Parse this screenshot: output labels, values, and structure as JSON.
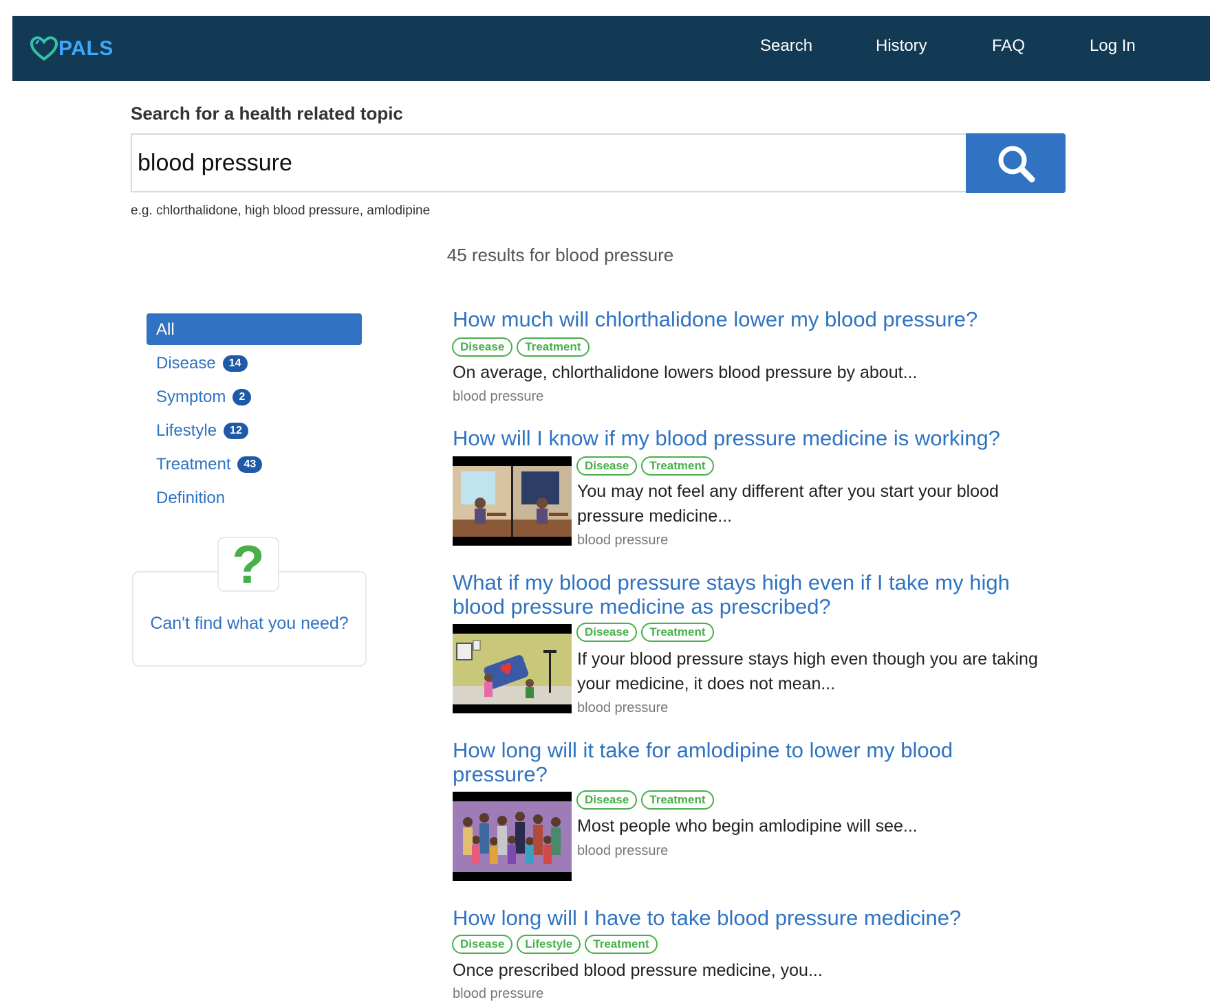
{
  "brand": {
    "name": "PALS",
    "colors": {
      "nav_bg": "#123a54",
      "accent": "#2f73c2",
      "tag_green": "#47b04a"
    }
  },
  "nav": {
    "links": [
      "Search",
      "History",
      "FAQ",
      "Log In"
    ]
  },
  "search": {
    "label": "Search for a health related topic",
    "value": "blood pressure",
    "button_icon": "search-icon",
    "hint": "e.g. chlorthalidone, high blood pressure, amlodipine"
  },
  "results_summary": "45 results for blood pressure",
  "sidebar": {
    "all_label": "All",
    "categories": [
      {
        "label": "Disease",
        "count": "14"
      },
      {
        "label": "Symptom",
        "count": "2"
      },
      {
        "label": "Lifestyle",
        "count": "12"
      },
      {
        "label": "Treatment",
        "count": "43"
      },
      {
        "label": "Definition",
        "count": ""
      }
    ],
    "help": {
      "icon": "question-mark-icon",
      "text": "Can't find what you need?"
    }
  },
  "results": [
    {
      "title": "How much will chlorthalidone lower my blood pressure?",
      "tags": [
        "Disease",
        "Treatment"
      ],
      "snippet": "On average, chlorthalidone lowers blood pressure by about...",
      "keyword": "blood pressure"
    },
    {
      "title": "How will I know if my blood pressure medicine is working?",
      "tags": [
        "Disease",
        "Treatment"
      ],
      "snippet_line1": "You may not feel any different after you start your blood",
      "snippet_line2": "pressure medicine...",
      "keyword": "blood pressure"
    },
    {
      "title_line1": "What if my blood pressure stays high even if I take my high",
      "title_line2": "blood pressure medicine as prescribed?",
      "tags": [
        "Disease",
        "Treatment"
      ],
      "snippet_line1": "If your blood pressure stays high even though you are taking",
      "snippet_line2": "your medicine, it does not mean...",
      "keyword": "blood pressure"
    },
    {
      "title_line1": "How long will it take for amlodipine to lower my blood",
      "title_line2": "pressure?",
      "tags": [
        "Disease",
        "Treatment"
      ],
      "snippet": "Most people who begin amlodipine will see...",
      "keyword": "blood pressure"
    },
    {
      "title": "How long will I have to take blood pressure medicine?",
      "tags": [
        "Disease",
        "Lifestyle",
        "Treatment"
      ],
      "snippet": "Once prescribed blood pressure medicine, you...",
      "keyword": "blood pressure"
    }
  ]
}
